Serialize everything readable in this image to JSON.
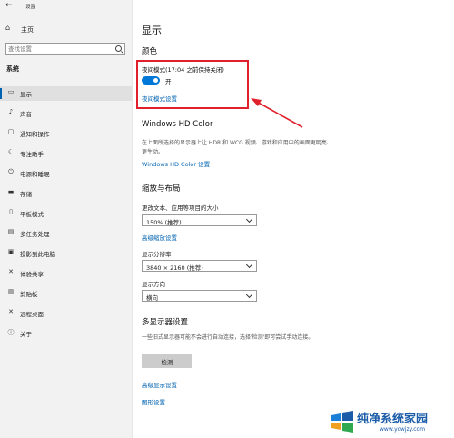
{
  "window": {
    "title": "设置"
  },
  "sidebar": {
    "home_label": "主页",
    "search_placeholder": "查找设置",
    "section_title": "系统",
    "items": [
      {
        "icon": "monitor-icon",
        "label": "显示",
        "active": true
      },
      {
        "icon": "speaker-icon",
        "label": "声音"
      },
      {
        "icon": "notification-icon",
        "label": "通知和操作"
      },
      {
        "icon": "focus-assist-icon",
        "label": "专注助手"
      },
      {
        "icon": "power-icon",
        "label": "电源和睡眠"
      },
      {
        "icon": "storage-icon",
        "label": "存储"
      },
      {
        "icon": "tablet-icon",
        "label": "平板模式"
      },
      {
        "icon": "multitasking-icon",
        "label": "多任务处理"
      },
      {
        "icon": "projecting-icon",
        "label": "投影到此电脑"
      },
      {
        "icon": "shared-experiences-icon",
        "label": "体验共享"
      },
      {
        "icon": "clipboard-icon",
        "label": "剪贴板"
      },
      {
        "icon": "remote-desktop-icon",
        "label": "远程桌面"
      },
      {
        "icon": "info-icon",
        "label": "关于"
      }
    ]
  },
  "main": {
    "page_title": "显示",
    "color": {
      "heading": "颜色",
      "night_light_label": "夜间模式(17:04 之前保持关闭)",
      "toggle_state": "开",
      "settings_link": "夜间模式设置"
    },
    "hdr": {
      "heading": "Windows HD Color",
      "description": "在上面所选择的显示器上让 HDR 和 WCG 视频、游戏和应用中的画面更明亮、更生动。",
      "settings_link": "Windows HD Color 设置"
    },
    "scale": {
      "heading": "缩放与布局",
      "text_size_label": "更改文本、应用等项目的大小",
      "text_size_value": "150% (推荐)",
      "advanced_link": "高级缩放设置",
      "resolution_label": "显示分辨率",
      "resolution_value": "3840 × 2160 (推荐)",
      "orientation_label": "显示方向",
      "orientation_value": "横向"
    },
    "multi": {
      "heading": "多显示器设置",
      "description": "一些旧式显示器可能不会进行自动连接，选择'检测'即可尝试手动连接。",
      "detect_button": "检测",
      "advanced_display_link": "高级显示设置",
      "graphics_link": "图形设置"
    }
  },
  "watermark": {
    "title": "纯净系统家园",
    "url": "www.ycwjzy.com"
  },
  "colors": {
    "accent": "#0078d7",
    "link": "#0063b1",
    "highlight": "#e0202a"
  }
}
